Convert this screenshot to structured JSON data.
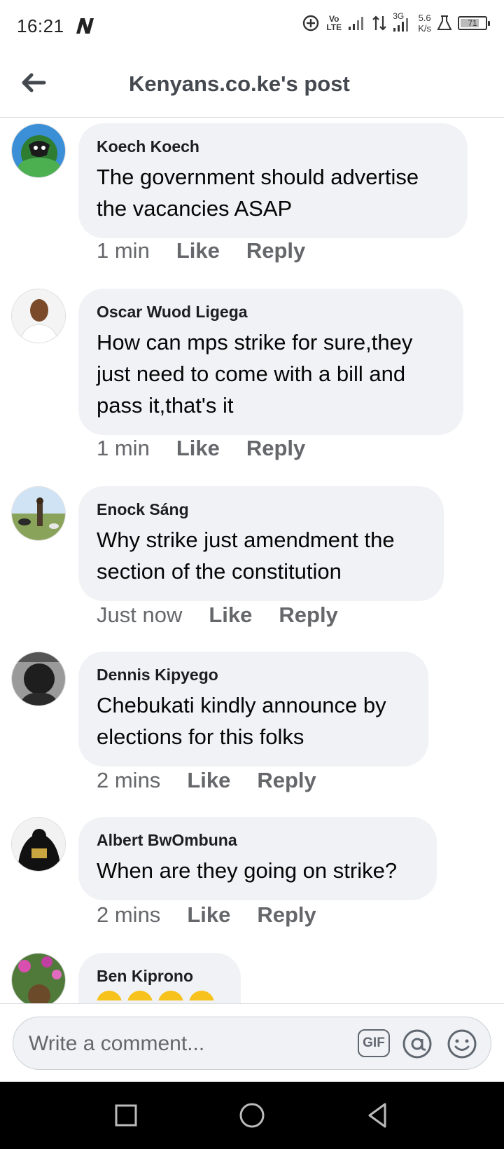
{
  "status_bar": {
    "time": "16:21",
    "network_label": "Vo LTE",
    "network_type": "3G",
    "speed_value": "5.6",
    "speed_unit": "K/s",
    "battery": "71"
  },
  "header": {
    "title": "Kenyans.co.ke's post"
  },
  "comments": [
    {
      "author": "Koech Koech",
      "text": "The government should advertise the vacancies ASAP",
      "time": "1 min",
      "like": "Like",
      "reply": "Reply"
    },
    {
      "author": "Oscar Wuod Ligega",
      "text": "How can mps strike for sure,they just need to come with a bill and pass it,that's it",
      "time": "1 min",
      "like": "Like",
      "reply": "Reply"
    },
    {
      "author": "Enock Sáng",
      "text": "Why strike just amendment the section of the constitution",
      "time": "Just now",
      "like": "Like",
      "reply": "Reply"
    },
    {
      "author": "Dennis Kipyego",
      "text": "Chebukati kindly announce by elections for this folks",
      "time": "2 mins",
      "like": "Like",
      "reply": "Reply"
    },
    {
      "author": "Albert BwOmbuna",
      "text": "When are they going on strike?",
      "time": "2 mins",
      "like": "Like",
      "reply": "Reply"
    },
    {
      "author": "Ben Kiprono",
      "text": ""
    }
  ],
  "composer": {
    "placeholder": "Write a comment...",
    "gif_label": "GIF"
  },
  "colors": {
    "bubble": "#f0f2f5",
    "meta_text": "#65676b",
    "nav_bar": "#000000"
  }
}
